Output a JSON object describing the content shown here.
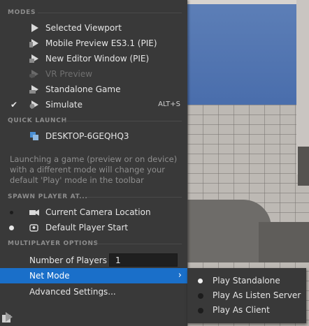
{
  "sections": {
    "modes": "MODES",
    "quick_launch": "QUICK LAUNCH",
    "spawn_player": "SPAWN PLAYER AT...",
    "multiplayer": "MULTIPLAYER OPTIONS"
  },
  "modes": [
    {
      "label": "Selected Viewport",
      "icon": "play-icon",
      "enabled": true
    },
    {
      "label": "Mobile Preview ES3.1 (PIE)",
      "icon": "mobile-preview-icon",
      "enabled": true
    },
    {
      "label": "New Editor Window (PIE)",
      "icon": "editor-window-icon",
      "enabled": true
    },
    {
      "label": "VR Preview",
      "icon": "vr-icon",
      "enabled": false
    },
    {
      "label": "Standalone Game",
      "icon": "standalone-icon",
      "enabled": true
    },
    {
      "label": "Simulate",
      "icon": "simulate-icon",
      "enabled": true,
      "checked": true,
      "shortcut": "ALT+S"
    }
  ],
  "quick_launch": {
    "device": "DESKTOP-6GEQHQ3",
    "icon": "device-icon"
  },
  "note": "Launching a game (preview or on device) with a different mode will change your default 'Play' mode in the toolbar",
  "spawn": [
    {
      "label": "Current Camera Location",
      "icon": "camera-icon",
      "selected": false
    },
    {
      "label": "Default Player Start",
      "icon": "player-start-icon",
      "selected": true
    }
  ],
  "multiplayer": {
    "players_label": "Number of Players",
    "players_value": "1",
    "net_mode_label": "Net Mode",
    "advanced_label": "Advanced Settings..."
  },
  "net_mode_options": [
    {
      "label": "Play Standalone",
      "selected": true
    },
    {
      "label": "Play As Listen Server",
      "selected": false
    },
    {
      "label": "Play As Client",
      "selected": false
    }
  ],
  "colors": {
    "highlight": "#1a6fc9",
    "menu_bg": "#393939",
    "sky": "#4a6eae"
  }
}
